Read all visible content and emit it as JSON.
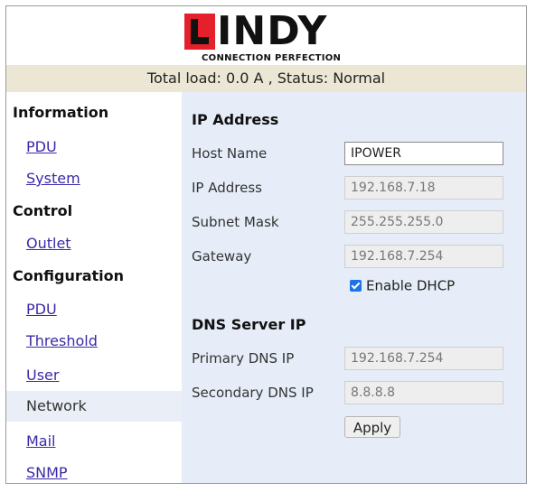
{
  "brand": {
    "logo_text": "LINDY",
    "logo_rest": "INDY",
    "tagline": "CONNECTION PERFECTION",
    "colors": {
      "red": "#e4202a",
      "black": "#111111"
    }
  },
  "status": {
    "text": "Total load: 0.0 A , Status: Normal"
  },
  "sidebar": {
    "information_heading": "Information",
    "info_pdu": "PDU",
    "info_system": "System",
    "control_heading": "Control",
    "control_outlet": "Outlet",
    "configuration_heading": "Configuration",
    "config_pdu": "PDU",
    "config_threshold": "Threshold",
    "config_user": "User",
    "config_network": "Network",
    "config_mail": "Mail",
    "config_snmp": "SNMP"
  },
  "ip_section": {
    "title": "IP Address",
    "host_name_label": "Host Name",
    "host_name_value": "IPOWER",
    "ip_label": "IP Address",
    "ip_value": "192.168.7.18",
    "subnet_label": "Subnet Mask",
    "subnet_value": "255.255.255.0",
    "gateway_label": "Gateway",
    "gateway_value": "192.168.7.254",
    "dhcp_label": "Enable DHCP",
    "dhcp_checked": true
  },
  "dns_section": {
    "title": "DNS Server IP",
    "primary_label": "Primary DNS IP",
    "primary_value": "192.168.7.254",
    "secondary_label": "Secondary DNS IP",
    "secondary_value": "8.8.8.8"
  },
  "actions": {
    "apply_label": "Apply"
  }
}
